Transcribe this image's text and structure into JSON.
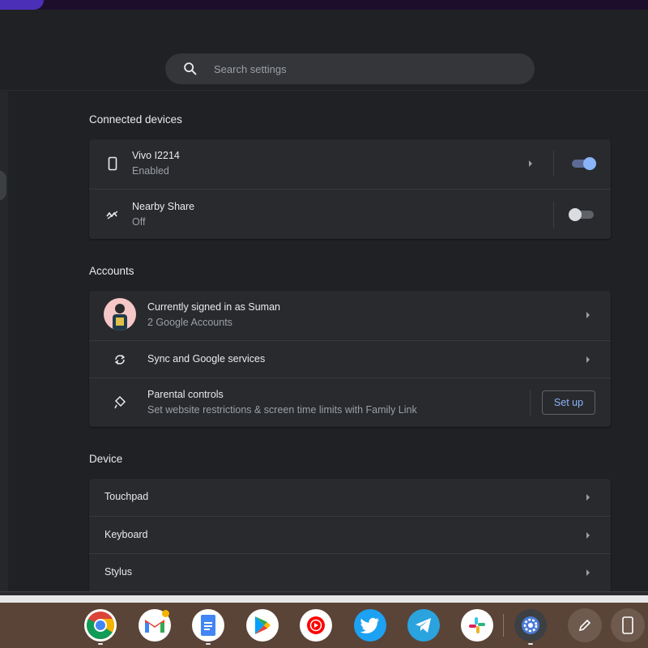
{
  "search": {
    "placeholder": "Search settings"
  },
  "sections": {
    "connected_devices": {
      "title": "Connected devices",
      "phone": {
        "name": "Vivo I2214",
        "status": "Enabled",
        "toggle_on": true
      },
      "nearby": {
        "name": "Nearby Share",
        "status": "Off",
        "toggle_on": false
      }
    },
    "accounts": {
      "title": "Accounts",
      "signed_in": {
        "title": "Currently signed in as Suman",
        "subtitle": "2 Google Accounts"
      },
      "sync": {
        "title": "Sync and Google services"
      },
      "parental": {
        "title": "Parental controls",
        "subtitle": "Set website restrictions & screen time limits with Family Link",
        "button": "Set up"
      }
    },
    "device": {
      "title": "Device",
      "items": [
        {
          "label": "Touchpad"
        },
        {
          "label": "Keyboard"
        },
        {
          "label": "Stylus"
        }
      ]
    }
  },
  "shelf": {
    "apps": [
      "chrome-icon",
      "gmail-icon",
      "docs-icon",
      "play-store-icon",
      "youtube-music-icon",
      "twitter-icon",
      "telegram-icon",
      "slack-icon",
      "settings-icon"
    ],
    "tray": [
      "stylus-tool-icon",
      "phone-hub-icon"
    ]
  },
  "colors": {
    "accent": "#8ab4f8",
    "background": "#202124",
    "card": "#292a2d",
    "shelf": "#5a4437"
  }
}
